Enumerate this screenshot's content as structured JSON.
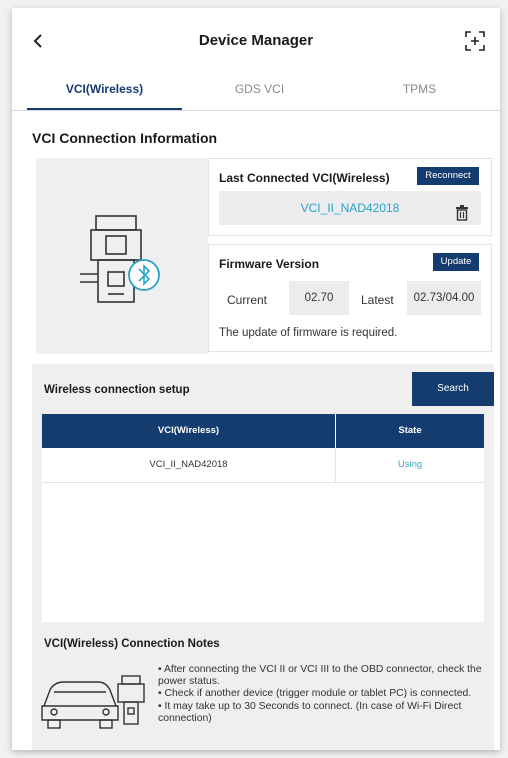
{
  "header": {
    "title": "Device Manager",
    "back_icon": "chevron-left-icon",
    "expand_icon": "fullscreen-plus-icon"
  },
  "tabs": [
    {
      "label": "VCI(Wireless)",
      "active": true
    },
    {
      "label": "GDS VCI",
      "active": false
    },
    {
      "label": "TPMS",
      "active": false
    }
  ],
  "connection": {
    "section_title": "VCI Connection Information",
    "device_icon": "vci-bluetooth-device-icon",
    "last_connected": {
      "title": "Last Connected VCI(Wireless)",
      "reconnect_label": "Reconnect",
      "device_name": "VCI_II_NAD42018",
      "delete_icon": "trash-icon"
    },
    "firmware": {
      "title": "Firmware Version",
      "update_label": "Update",
      "current_label": "Current",
      "current_value": "02.70",
      "latest_label": "Latest",
      "latest_value": "02.73/04.00",
      "note": "The update of firmware is required."
    }
  },
  "wireless_setup": {
    "title": "Wireless connection setup",
    "search_label": "Search",
    "columns": [
      "VCI(Wireless)",
      "State"
    ],
    "rows": [
      {
        "name": "VCI_II_NAD42018",
        "state": "Using"
      }
    ]
  },
  "notes": {
    "title": "VCI(Wireless) Connection Notes",
    "illustration": "car-with-vci-icon",
    "items": [
      "• After connecting the VCI II or VCI III to the OBD connector, check the power status.",
      "• Check if another device (trigger module or tablet PC) is connected.",
      "• It may take up to 30 Seconds to connect. (In case of Wi-Fi Direct connection)"
    ]
  },
  "colors": {
    "navy": "#153c6e",
    "accent_text": "#2aa3c8",
    "panel_gray": "#f0efef"
  }
}
